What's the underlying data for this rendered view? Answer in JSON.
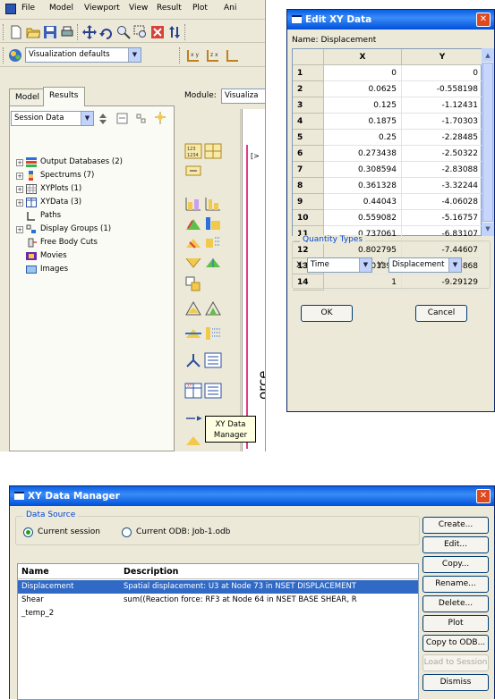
{
  "main_window": {
    "menu": [
      "File",
      "Model",
      "Viewport",
      "View",
      "Result",
      "Plot",
      "Ani"
    ],
    "visualization_combo": "Visualization defaults",
    "tabs": [
      {
        "label": "Model"
      },
      {
        "label": "Results"
      }
    ],
    "module_label": "Module:",
    "module_value": "Visualiza",
    "session_combo": "Session Data",
    "tree": [
      {
        "label": "Output Databases (2)",
        "expandable": true
      },
      {
        "label": "Spectrums (7)",
        "expandable": true
      },
      {
        "label": "XYPlots (1)",
        "expandable": true
      },
      {
        "label": "XYData (3)",
        "expandable": true
      },
      {
        "label": "Paths",
        "expandable": false
      },
      {
        "label": "Display Groups (1)",
        "expandable": true
      },
      {
        "label": "Free Body Cuts",
        "expandable": false
      },
      {
        "label": "Movies",
        "expandable": false
      },
      {
        "label": "Images",
        "expandable": false
      }
    ],
    "tooltip": [
      "XY Data",
      "Manager"
    ],
    "viewport_label": "orce",
    "viewport_marker": "[>"
  },
  "edit_dialog": {
    "title": "Edit XY Data",
    "name_line": "Name: Displacement",
    "columns": [
      "X",
      "Y"
    ],
    "rows": [
      {
        "n": "1",
        "x": "0",
        "y": "0"
      },
      {
        "n": "2",
        "x": "0.0625",
        "y": "-0.558198"
      },
      {
        "n": "3",
        "x": "0.125",
        "y": "-1.12431"
      },
      {
        "n": "4",
        "x": "0.1875",
        "y": "-1.70303"
      },
      {
        "n": "5",
        "x": "0.25",
        "y": "-2.28485"
      },
      {
        "n": "6",
        "x": "0.273438",
        "y": "-2.50322"
      },
      {
        "n": "7",
        "x": "0.308594",
        "y": "-2.83088"
      },
      {
        "n": "8",
        "x": "0.361328",
        "y": "-3.32244"
      },
      {
        "n": "9",
        "x": "0.44043",
        "y": "-4.06028"
      },
      {
        "n": "10",
        "x": "0.559082",
        "y": "-5.16757"
      },
      {
        "n": "11",
        "x": "0.737061",
        "y": "-6.83107"
      },
      {
        "n": "12",
        "x": "0.802795",
        "y": "-7.44607"
      },
      {
        "n": "13",
        "x": "0.901398",
        "y": "-8.36868"
      },
      {
        "n": "14",
        "x": "1",
        "y": "-9.29129"
      }
    ],
    "quantity_types_label": "Quantity Types",
    "x_label": "X:",
    "x_value": "Time",
    "y_label": "Y:",
    "y_value": "Displacement",
    "ok": "OK",
    "cancel": "Cancel"
  },
  "manager_dialog": {
    "title": "XY Data Manager",
    "data_source_label": "Data Source",
    "radio_session": "Current session",
    "radio_odb": "Current ODB:  Job-1.odb",
    "headers": [
      "Name",
      "Description"
    ],
    "rows": [
      {
        "name": "Displacement",
        "description": "Spatial displacement: U3 at Node 73 in NSET DISPLACEMENT",
        "selected": true
      },
      {
        "name": "Shear",
        "description": "sum((Reaction force: RF3 at Node 64 in NSET BASE SHEAR, R",
        "selected": false
      },
      {
        "name": "_temp_2",
        "description": "",
        "selected": false
      }
    ],
    "buttons": {
      "create": "Create...",
      "edit": "Edit...",
      "copy": "Copy...",
      "rename": "Rename...",
      "delete": "Delete...",
      "plot": "Plot",
      "copy_to_odb": "Copy to ODB...",
      "load_to_session": "Load to Session",
      "dismiss": "Dismiss"
    }
  },
  "colors": {
    "titlebar": "#0a5ee3",
    "selection": "#316ac5",
    "dialog_bg": "#ece9d8",
    "tooltip_bg": "#ffffe1",
    "group_label": "#0046d5"
  }
}
